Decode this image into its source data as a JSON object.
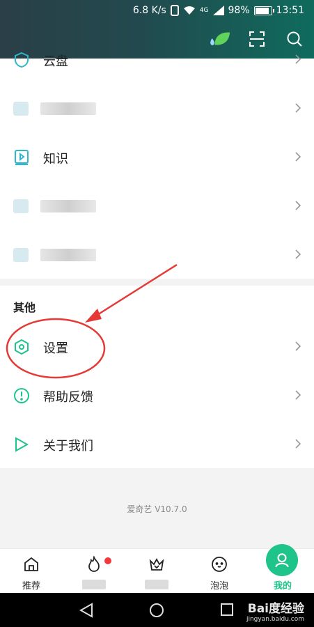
{
  "status_bar": {
    "speed": "6.8 K/s",
    "network": "4G",
    "battery": "98%",
    "time": "13:51"
  },
  "header": {
    "icons": [
      "leaf-icon",
      "scan-icon",
      "search-icon"
    ]
  },
  "list_top": {
    "items": [
      {
        "label": "云盘",
        "icon": "cloud-shield-icon"
      },
      {
        "label": "",
        "icon": "blurred-icon"
      },
      {
        "label": "知识",
        "icon": "knowledge-video-icon"
      },
      {
        "label": "",
        "icon": "blurred-icon"
      },
      {
        "label": "",
        "icon": "blurred-icon"
      }
    ]
  },
  "others": {
    "title": "其他",
    "items": [
      {
        "label": "设置",
        "icon": "settings-hexagon-icon"
      },
      {
        "label": "帮助反馈",
        "icon": "help-exclamation-icon"
      },
      {
        "label": "关于我们",
        "icon": "about-play-icon"
      }
    ]
  },
  "version": "爱奇艺 V10.7.0",
  "bottom_nav": {
    "items": [
      {
        "label": "推荐",
        "icon": "home-icon"
      },
      {
        "label": "",
        "icon": "flame-icon"
      },
      {
        "label": "",
        "icon": "crown-icon"
      },
      {
        "label": "泡泡",
        "icon": "bubble-face-icon"
      },
      {
        "label": "我的",
        "icon": "profile-icon"
      }
    ]
  },
  "watermark": {
    "brand": "Bai度经验",
    "url": "jingyan.baidu.com"
  },
  "colors": {
    "accent": "#1ec489",
    "annotation": "#e53935",
    "badge": "#f13a3a"
  }
}
